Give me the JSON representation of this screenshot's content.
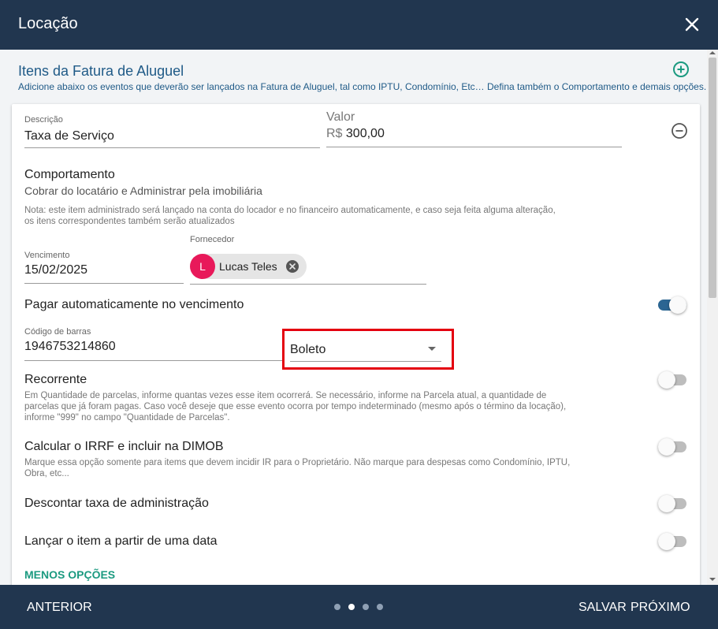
{
  "dialog": {
    "title": "Locação"
  },
  "section": {
    "title": "Itens da Fatura de Aluguel",
    "subtitle": "Adicione abaixo os eventos que deverão ser lançados na Fatura de Aluguel, tal como IPTU, Condomínio, Etc… Defina também o Comportamento e demais opções."
  },
  "item": {
    "descricao": {
      "label": "Descrição",
      "value": "Taxa de Serviço"
    },
    "valor": {
      "label": "Valor",
      "prefix": "R$",
      "value": "300,00"
    },
    "comportamento": {
      "title": "Comportamento",
      "value": "Cobrar do locatário e Administrar pela imobiliária",
      "note_line1": "Nota: este item administrado será lançado na conta do locador e no financeiro automaticamente, e caso seja feita alguma alteração,",
      "note_line2": "os itens correspondentes também serão atualizados"
    },
    "vencimento": {
      "label": "Vencimento",
      "value": "15/02/2025"
    },
    "fornecedor": {
      "label": "Fornecedor",
      "initial": "L",
      "name": "Lucas Teles"
    },
    "pagar_auto": {
      "label": "Pagar automaticamente no vencimento",
      "on": true
    },
    "codigo_barras": {
      "label": "Código de barras",
      "value": "1946753214860"
    },
    "tipo_pagamento": {
      "value": "Boleto"
    },
    "recorrente": {
      "label": "Recorrente",
      "on": false,
      "note_line1": "Em Quantidade de parcelas, informe quantas vezes esse item ocorrerá. Se necessário, informe na Parcela atual, a quantidade de",
      "note_line2": "parcelas que já foram pagas. Caso você deseje que esse evento ocorra por tempo indeterminado (mesmo após o término da locação),",
      "note_line3": "informe \"999\" no campo \"Quantidade de Parcelas\"."
    },
    "irrf": {
      "label": "Calcular o IRRF e incluir na DIMOB",
      "on": false,
      "note_line1": "Marque essa opção somente para items que devem incidir IR para o Proprietário. Não marque para despesas como Condomínio, IPTU,",
      "note_line2": "Obra, etc..."
    },
    "desconto": {
      "label": "Descontar taxa de administração",
      "on": false
    },
    "lancar_data": {
      "label": "Lançar o item a partir de uma data",
      "on": false
    },
    "menos_opcoes": "MENOS OPÇÕES"
  },
  "footer": {
    "anterior": "ANTERIOR",
    "salvar": "SALVAR",
    "proximo": "PRÓXIMO",
    "steps_total": 4,
    "step_active": 2
  },
  "colors": {
    "header_bg": "#21364f",
    "accent_blue": "#1f5a87",
    "toggle_on": "#2b6592",
    "accent_green": "#1b9a80",
    "avatar": "#e8195a",
    "highlight": "#e4000f"
  }
}
